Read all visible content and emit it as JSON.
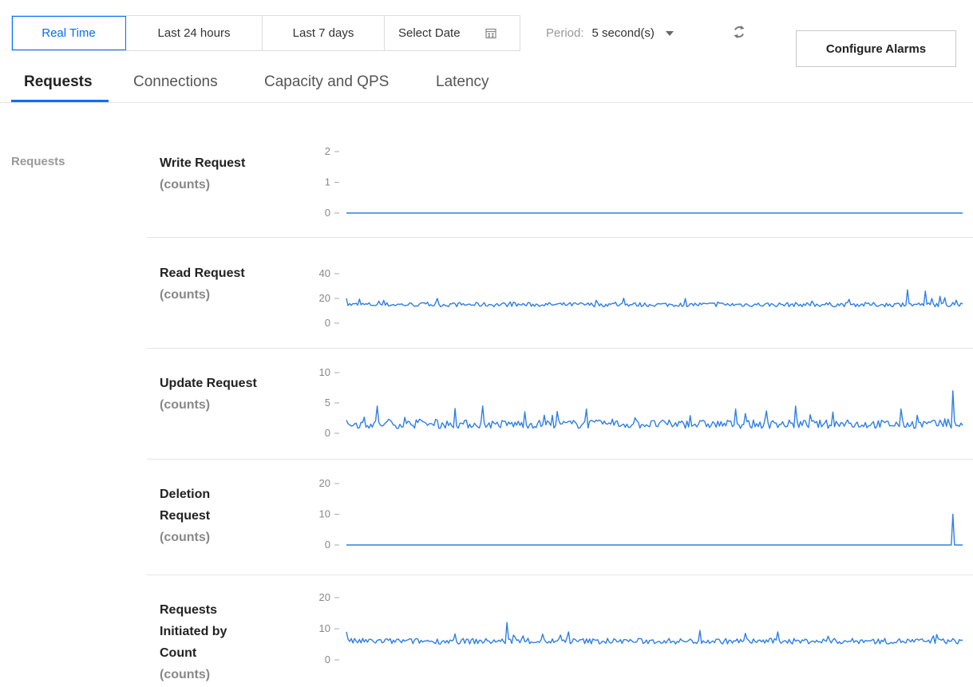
{
  "time_range": {
    "buttons": [
      "Real Time",
      "Last 24 hours",
      "Last 7 days",
      "Select Date"
    ],
    "active_index": 0,
    "calendar_icon": "calendar-icon"
  },
  "period": {
    "label": "Period:",
    "value": "5 second(s)"
  },
  "refresh_icon": "refresh-icon",
  "configure_alarms_label": "Configure Alarms",
  "tabs": [
    {
      "label": "Requests",
      "active": true
    },
    {
      "label": "Connections",
      "active": false
    },
    {
      "label": "Capacity and QPS",
      "active": false
    },
    {
      "label": "Latency",
      "active": false
    }
  ],
  "section_label": "Requests",
  "accent_color": "#006eff",
  "series_color": "#2f7fe6",
  "metrics": [
    {
      "title_lines": [
        "Write Request"
      ],
      "unit": "(counts)"
    },
    {
      "title_lines": [
        "Read Request"
      ],
      "unit": "(counts)"
    },
    {
      "title_lines": [
        "Update Request"
      ],
      "unit": "(counts)"
    },
    {
      "title_lines": [
        "Deletion",
        "Request"
      ],
      "unit": "(counts)"
    },
    {
      "title_lines": [
        "Requests",
        "Initiated by",
        "Count"
      ],
      "unit": "(counts)"
    }
  ],
  "chart_data": [
    {
      "type": "line",
      "title": "Write Request",
      "ylabel": "(counts)",
      "yticks": [
        0,
        1,
        2
      ],
      "ylim": [
        0,
        2
      ],
      "baseline": 0,
      "noise": 0,
      "spikes": []
    },
    {
      "type": "line",
      "title": "Read Request",
      "ylabel": "(counts)",
      "yticks": [
        0,
        20,
        40
      ],
      "ylim": [
        0,
        40
      ],
      "baseline": 15,
      "noise": 2.5,
      "spikes": [
        [
          0.0,
          20
        ],
        [
          0.55,
          20
        ],
        [
          0.91,
          27
        ],
        [
          0.94,
          26
        ],
        [
          0.95,
          20
        ]
      ]
    },
    {
      "type": "line",
      "title": "Update Request",
      "ylabel": "(counts)",
      "yticks": [
        0,
        5,
        10
      ],
      "ylim": [
        0,
        10
      ],
      "baseline": 1.5,
      "noise": 1.0,
      "spikes": [
        [
          0.05,
          4.5
        ],
        [
          0.22,
          4.5
        ],
        [
          0.39,
          4
        ],
        [
          0.73,
          4.5
        ],
        [
          0.9,
          4
        ],
        [
          0.985,
          7
        ]
      ]
    },
    {
      "type": "line",
      "title": "Deletion Request",
      "ylabel": "(counts)",
      "yticks": [
        0,
        10,
        20
      ],
      "ylim": [
        0,
        20
      ],
      "baseline": 0,
      "noise": 0,
      "spikes": [
        [
          0.985,
          10
        ]
      ]
    },
    {
      "type": "line",
      "title": "Requests Initiated by Count",
      "ylabel": "(counts)",
      "yticks": [
        0,
        10,
        20
      ],
      "ylim": [
        0,
        20
      ],
      "baseline": 6,
      "noise": 1.3,
      "spikes": [
        [
          0.0,
          9
        ],
        [
          0.26,
          12
        ],
        [
          0.36,
          9
        ],
        [
          0.7,
          9
        ]
      ]
    }
  ]
}
